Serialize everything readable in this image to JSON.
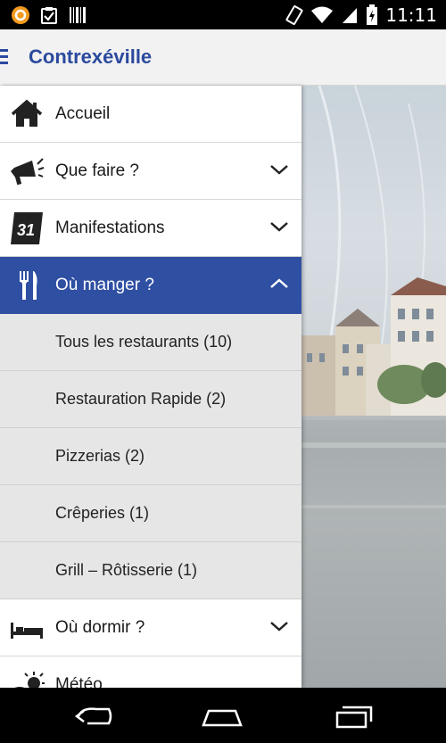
{
  "status_bar": {
    "time": "11:11"
  },
  "app_bar": {
    "title": "Contrexéville"
  },
  "drawer": {
    "items": [
      {
        "label": "Accueil",
        "icon": "home-icon"
      },
      {
        "label": "Que faire ?",
        "icon": "megaphone-icon"
      },
      {
        "label": "Manifestations",
        "icon": "calendar-icon",
        "calendar_day": "31"
      },
      {
        "label": "Où manger ?",
        "icon": "fork-knife-icon",
        "expanded": true
      },
      {
        "label": "Où dormir ?",
        "icon": "bed-icon"
      },
      {
        "label": "Météo",
        "icon": "weather-icon"
      }
    ],
    "sub_items": [
      {
        "label": "Tous les restaurants (10)"
      },
      {
        "label": "Restauration Rapide (2)"
      },
      {
        "label": "Pizzerias (2)"
      },
      {
        "label": "Crêperies (1)"
      },
      {
        "label": "Grill – Rôtisserie (1)"
      }
    ]
  },
  "colors": {
    "accent": "#2f4fa3",
    "title": "#2b4a9e",
    "sub_bg": "#e6e6e6"
  }
}
